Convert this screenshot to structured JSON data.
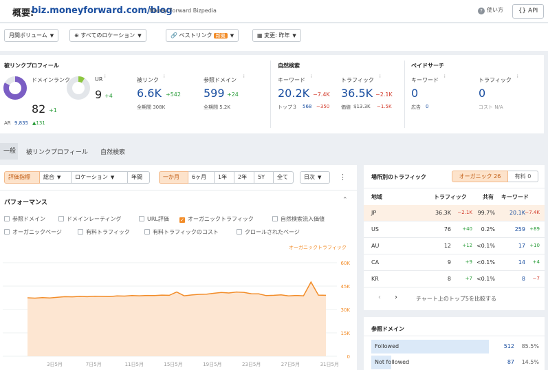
{
  "header": {
    "prefix": "概要:",
    "domain": "biz.moneyforward.com/blog",
    "subtitle": "Money Forward Bizpedia",
    "help": "使い方",
    "api": "API"
  },
  "filters": {
    "volume": "月間ボリューム",
    "location": "すべてのロケーション",
    "best": "ベストリンク",
    "new_badge": "新機",
    "change": "変更: 昨年"
  },
  "backlinks": {
    "section": "被リンクプロフィール",
    "dr_label": "ドメインランク",
    "dr_value": "82",
    "dr_delta": "+1",
    "ar_label": "AR",
    "ar_value": "9,835",
    "ar_delta": "▲131",
    "ur_label": "UR",
    "ur_value": "9",
    "ur_delta": "+4",
    "bl_label": "被リンク",
    "bl_value": "6.6K",
    "bl_delta": "+542",
    "bl_all": "全期間 308K",
    "rd_label": "参照ドメイン",
    "rd_value": "599",
    "rd_delta": "+24",
    "rd_all": "全期間 5.2K"
  },
  "organic": {
    "section": "自然検索",
    "kw_label": "キーワード",
    "kw_value": "20.2K",
    "kw_delta": "−7.4K",
    "kw_top3": "トップ３",
    "kw_top3_value": "568",
    "kw_top3_delta": "−350",
    "tr_label": "トラフィック",
    "tr_value": "36.5K",
    "tr_delta": "−2.1K",
    "tr_value_label": "価値",
    "tr_price": "$13.3K",
    "tr_price_delta": "−1.5K"
  },
  "paid": {
    "section": "ペイドサーチ",
    "kw_label": "キーワード",
    "kw_value": "0",
    "ad_label": "広告",
    "ad_value": "0",
    "tr_label": "トラフィック",
    "tr_value": "0",
    "cost_label": "コスト N/A"
  },
  "tabs": [
    "一般",
    "被リンクプロフィール",
    "自然検索"
  ],
  "perf": {
    "chips": [
      "評価指標",
      "総合",
      "ロケーション",
      "年間"
    ],
    "ranges": [
      "一か月",
      "6ヶ月",
      "1年",
      "2年",
      "5Y",
      "全て"
    ],
    "interval": "日次",
    "title": "パフォーマンス",
    "checks_row1": [
      "参照ドメイン",
      "ドメインレーティング",
      "URL評価",
      "オーガニックトラフィック",
      "自然検索流入価値"
    ],
    "checks_row2": [
      "オーガニックページ",
      "有料トラフィック",
      "有料トラフィックのコスト",
      "クロールされたページ"
    ],
    "legend": "オーガニックトラフィック"
  },
  "chart_data": {
    "type": "area",
    "series": [
      {
        "name": "オーガニックトラフィック",
        "values": [
          37.5,
          37.3,
          37.6,
          37.4,
          37.8,
          38.2,
          38.1,
          38.4,
          38.2,
          38.5,
          38.4,
          38.3,
          38.7,
          38.6,
          38.9,
          38.8,
          39.0,
          38.9,
          39.2,
          39.1,
          41.2,
          38.8,
          39.3,
          39.7,
          39.8,
          40.4,
          40.9,
          40.6,
          41.2,
          41.0,
          40.1,
          40.0,
          38.9,
          39.1,
          39.4,
          38.7,
          39.0,
          38.8,
          47.6,
          39.2,
          39.1
        ]
      }
    ],
    "x_ticks": [
      "3日5月",
      "7日5月",
      "11日5月",
      "15日5月",
      "19日5月",
      "23日5月",
      "27日5月",
      "31日5月"
    ],
    "y_ticks": [
      "60K",
      "45K",
      "30K",
      "15K",
      "0"
    ],
    "ylim": [
      0,
      60
    ]
  },
  "traffic": {
    "title": "場所別のトラフィック",
    "toggle_a": "オーガニック 26",
    "toggle_b": "有料 0",
    "headers": [
      "地域",
      "トラフィック",
      "共有",
      "キーワード"
    ],
    "rows": [
      {
        "c": "JP",
        "t": "36.3K",
        "td": "−2.1K",
        "s": "99.7%",
        "k": "20.1K",
        "kd": "−7.4K"
      },
      {
        "c": "US",
        "t": "76",
        "td": "+40",
        "s": "0.2%",
        "k": "259",
        "kd": "+89"
      },
      {
        "c": "AU",
        "t": "12",
        "td": "+12",
        "s": "<0.1%",
        "k": "17",
        "kd": "+10"
      },
      {
        "c": "CA",
        "t": "9",
        "td": "+9",
        "s": "<0.1%",
        "k": "14",
        "kd": "+4"
      },
      {
        "c": "KR",
        "t": "8",
        "td": "+7",
        "s": "<0.1%",
        "k": "8",
        "kd": "−7"
      }
    ],
    "compare": "チャート上のトップ5を比較する"
  },
  "refdomains": {
    "title": "参照ドメイン",
    "rows": [
      {
        "label": "Followed",
        "value": "512",
        "pct": "85.5%",
        "frac": 0.855
      },
      {
        "label": "Not followed",
        "value": "87",
        "pct": "14.5%",
        "frac": 0.145
      }
    ]
  },
  "colors": {
    "accent": "#f28c28",
    "link": "#1b4fa0",
    "up": "#2a9d3a",
    "down": "#d23a2a",
    "dr": "#7b5ec4",
    "ur": "#8cc63f"
  }
}
